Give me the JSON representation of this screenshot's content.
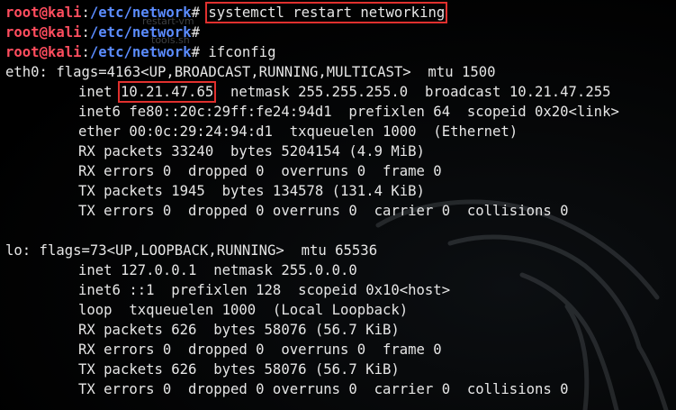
{
  "prompt": {
    "user": "root",
    "at": "@",
    "host": "kali",
    "colon": ":",
    "path": "/etc/network",
    "hash": "# "
  },
  "ghost_texts": [
    "restart-vm",
    "tools.sh"
  ],
  "commands": [
    "systemctl restart networking",
    "",
    "ifconfig"
  ],
  "output": {
    "eth0_header": "eth0: flags=4163<UP,BROADCAST,RUNNING,MULTICAST>  mtu 1500",
    "eth0_inet_label": "inet ",
    "eth0_inet_addr": "10.21.47.65",
    "eth0_inet_rest": "  netmask 255.255.255.0  broadcast 10.21.47.255",
    "eth0_inet6": "inet6 fe80::20c:29ff:fe24:94d1  prefixlen 64  scopeid 0x20<link>",
    "eth0_ether": "ether 00:0c:29:24:94:d1  txqueuelen 1000  (Ethernet)",
    "eth0_rx_packets": "RX packets 33240  bytes 5204154 (4.9 MiB)",
    "eth0_rx_errors": "RX errors 0  dropped 0  overruns 0  frame 0",
    "eth0_tx_packets": "TX packets 1945  bytes 134578 (131.4 KiB)",
    "eth0_tx_errors": "TX errors 0  dropped 0 overruns 0  carrier 0  collisions 0",
    "lo_header": "lo: flags=73<UP,LOOPBACK,RUNNING>  mtu 65536",
    "lo_inet": "inet 127.0.0.1  netmask 255.0.0.0",
    "lo_inet6": "inet6 ::1  prefixlen 128  scopeid 0x10<host>",
    "lo_loop": "loop  txqueuelen 1000  (Local Loopback)",
    "lo_rx_packets": "RX packets 626  bytes 58076 (56.7 KiB)",
    "lo_rx_errors": "RX errors 0  dropped 0  overruns 0  frame 0",
    "lo_tx_packets": "TX packets 626  bytes 58076 (56.7 KiB)",
    "lo_tx_errors": "TX errors 0  dropped 0 overruns 0  carrier 0  collisions 0"
  },
  "colors": {
    "background": "#000000",
    "prompt_user_host": "#ff4d5e",
    "prompt_path": "#5b8cff",
    "text": "#e6e6e6",
    "highlight_box": "#e0302e"
  }
}
